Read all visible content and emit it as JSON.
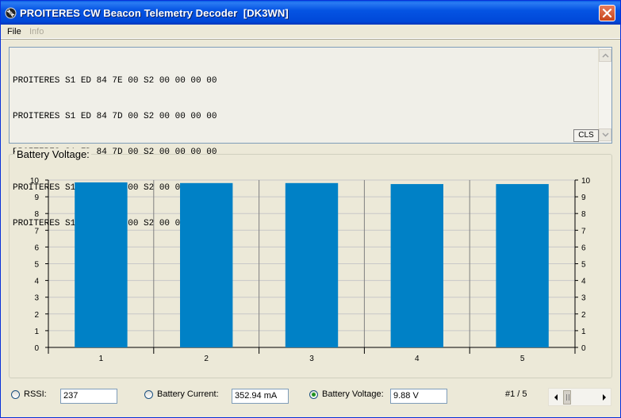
{
  "window": {
    "title": "PROITERES CW Beacon Telemetry Decoder  [DK3WN]",
    "title_icon": "satellite-app-icon",
    "close_icon": "close-icon",
    "accent": "#0054e3"
  },
  "menu": {
    "items": [
      {
        "label": "File",
        "enabled": true
      },
      {
        "label": "Info",
        "enabled": false
      }
    ]
  },
  "log": {
    "lines": [
      "PROITERES S1 ED 84 7E 00 S2 00 00 00 00",
      "PROITERES S1 ED 84 7D 00 S2 00 00 00 00",
      "PROITERES S1 ED 84 7D 00 S2 00 00 00 00",
      "PROITERES S1 ED 86 7C 00 S2 00 00 00 00",
      "PROITERES S1 ED 85 7C 00 S2 00 00 00 00"
    ],
    "cls_label": "CLS"
  },
  "chart_group": {
    "label": "Battery Voltage:"
  },
  "chart_data": {
    "type": "bar",
    "categories": [
      "1",
      "2",
      "3",
      "4",
      "5"
    ],
    "values": [
      9.86,
      9.82,
      9.82,
      9.76,
      9.76
    ],
    "title": "",
    "xlabel": "",
    "ylabel": "",
    "ylim": [
      0,
      10
    ],
    "yticks": [
      0,
      1,
      2,
      3,
      4,
      5,
      6,
      7,
      8,
      9,
      10
    ],
    "grid": true,
    "bar_color": "#0081c6",
    "axis_mirrored_right": true
  },
  "readouts": {
    "rssi": {
      "label": "RSSI:",
      "value": "237",
      "selected": false
    },
    "current": {
      "label": "Battery Current:",
      "value": "352.94 mA",
      "selected": false
    },
    "voltage": {
      "label": "Battery Voltage:",
      "value": "9.88 V",
      "selected": true
    },
    "counter": "#1 / 5"
  }
}
